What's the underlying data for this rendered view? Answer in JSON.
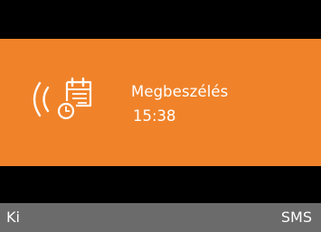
{
  "alert": {
    "icons": [
      "ringing-waves-icon",
      "calendar-reminder-icon"
    ],
    "title": "Megbeszélés",
    "time": "15:38",
    "background_color": "#f0832a"
  },
  "softkeys": {
    "left_label": "Ki",
    "right_label": "SMS",
    "bar_color": "#6b6b6b"
  }
}
